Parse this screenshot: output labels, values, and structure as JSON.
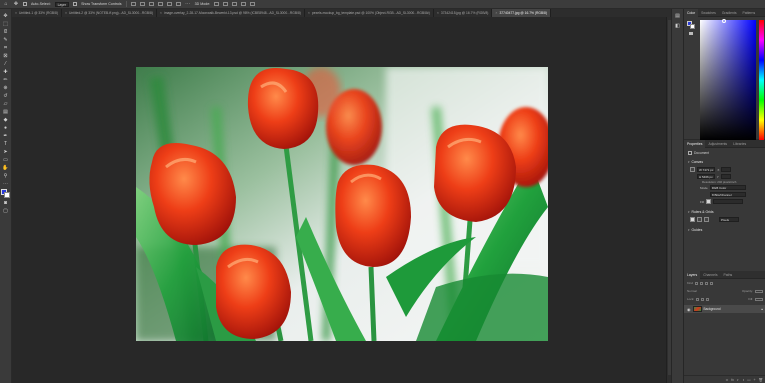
{
  "options_bar": {
    "auto_select_label": "Auto-Select:",
    "auto_select_value": "Layer",
    "show_transform_label": "Show Transform Controls",
    "mode_label": "3D Mode:"
  },
  "tabs": [
    {
      "label": "Untitled-1 @ 33% (RGB/8)",
      "active": false
    },
    {
      "label": "Untitled-2 @ 33% (NOTEB-ff.png)...AD_SL3000...RGB/8)",
      "active": false
    },
    {
      "label": "image-overlay_2-28-17-Moonwalk-Bewerkt-13.psd @ 98% (ICBE8948...AD_SL3000...RGB/8)",
      "active": false
    },
    {
      "label": "pexels-mockup_bg_template.psd @ 100% (Object-RGB...AD_SL3000...RGB/8#)",
      "active": false
    },
    {
      "label": "37342415.jpg @ 16.7% (RGB/8)",
      "active": false
    },
    {
      "label": "37740477.jpg @ 16.7% (RGB/8)",
      "active": true
    }
  ],
  "tools": [
    "move",
    "marquee",
    "lasso",
    "quick-select",
    "crop",
    "frame",
    "eyedropper",
    "healing",
    "brush",
    "clone",
    "history-brush",
    "eraser",
    "gradient",
    "blur",
    "dodge",
    "pen",
    "type",
    "path-select",
    "rectangle",
    "hand",
    "zoom",
    "more"
  ],
  "colors": {
    "foreground": "#2a3bd8",
    "background": "#ffffff"
  },
  "color_panel": {
    "tabs": [
      "Color",
      "Swatches",
      "Gradients",
      "Patterns"
    ],
    "active_tab": "Color"
  },
  "properties_panel": {
    "tabs": [
      "Properties",
      "Adjustments",
      "Libraries"
    ],
    "active_tab": "Properties",
    "doc_label": "Document",
    "canvas_section": "Canvas",
    "width": "W 7471 px",
    "height": "H 5466 px",
    "x_label": "X",
    "y_label": "Y",
    "resolution": "Resolution: 240 pixels/inch",
    "mode_label": "Mode",
    "mode_value": "RGB Color",
    "depth_value": "8 Bits/Channel",
    "fill_label": "Fill",
    "rulers_section": "Rulers & Grids",
    "ruler_unit": "Pixels",
    "guides_section": "Guides"
  },
  "layers_panel": {
    "tabs": [
      "Layers",
      "Channels",
      "Paths"
    ],
    "active_tab": "Layers",
    "kind_label": "Kind",
    "mode_value": "Normal",
    "opacity_label": "Opacity:",
    "lock_label": "Lock:",
    "fill_label": "Fill:",
    "layer_name": "Background"
  }
}
